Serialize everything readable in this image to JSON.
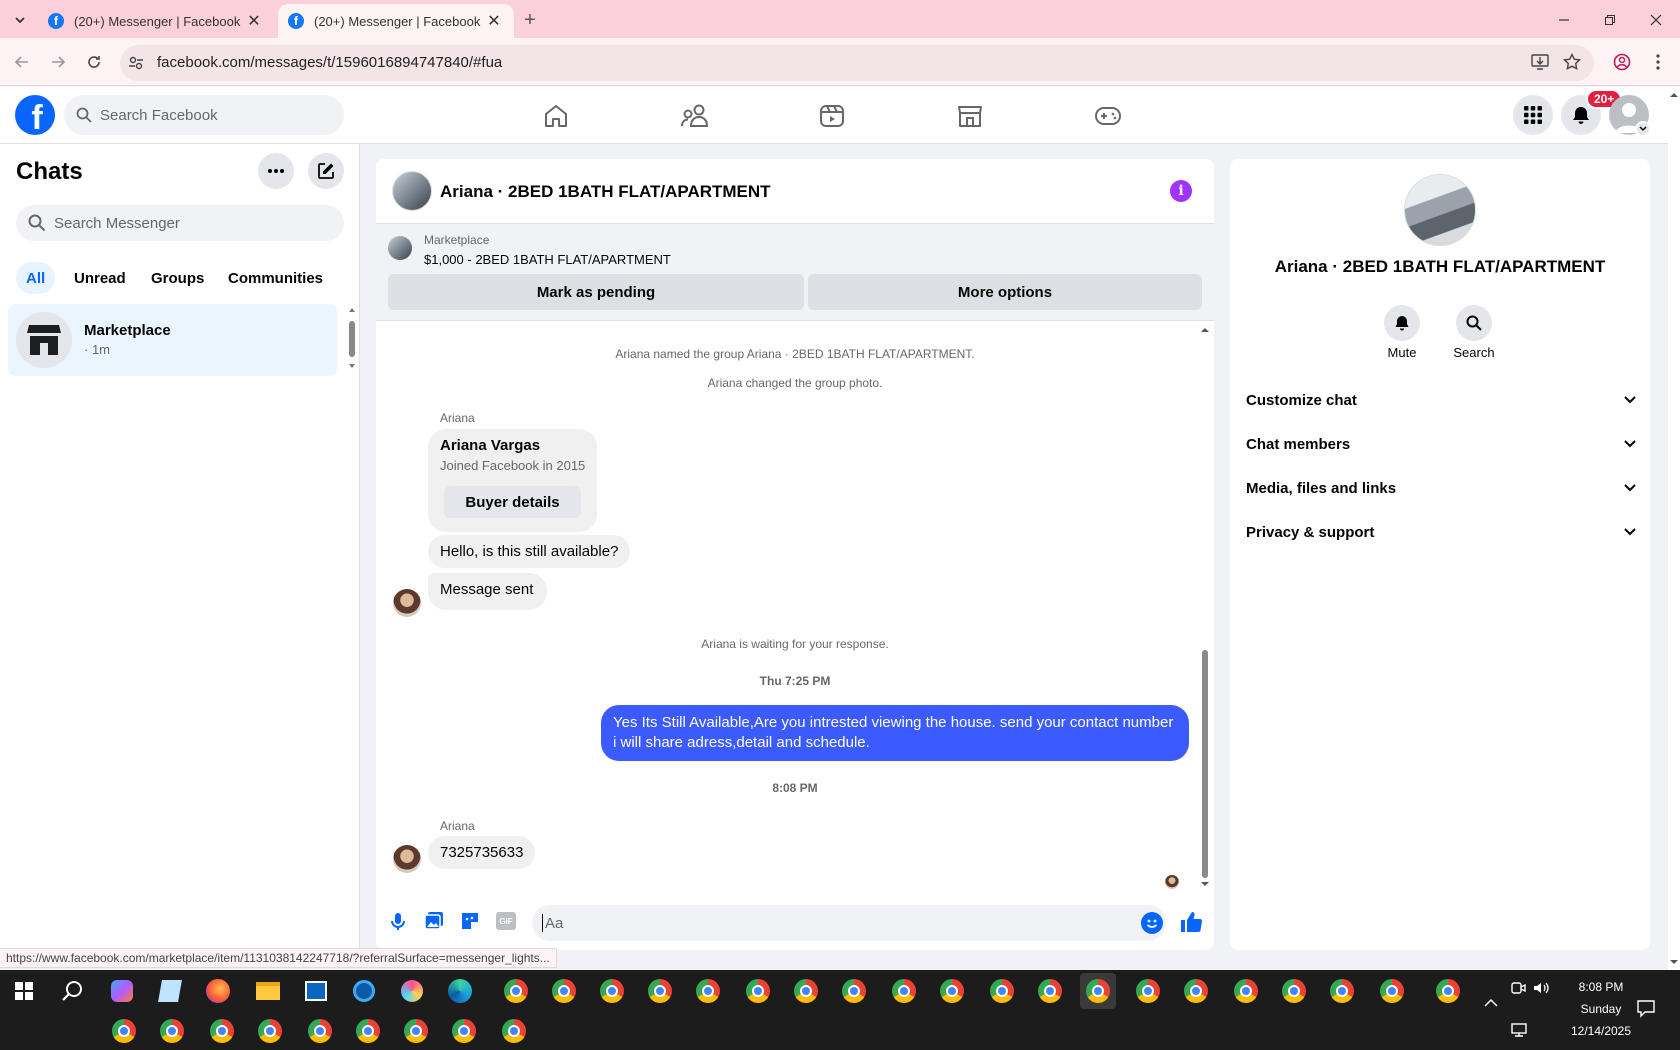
{
  "browser": {
    "tabs": [
      {
        "title": "(20+) Messenger | Facebook"
      },
      {
        "title": "(20+) Messenger | Facebook"
      }
    ],
    "url": "facebook.com/messages/t/1596016894747840/#fua",
    "status_url": "https://www.facebook.com/marketplace/item/1131038142247718/?referralSurface=messenger_lights..."
  },
  "fb": {
    "search_placeholder": "Search Facebook",
    "notification_badge": "20+"
  },
  "chats": {
    "title": "Chats",
    "search_placeholder": "Search Messenger",
    "filters": [
      "All",
      "Unread",
      "Groups",
      "Communities"
    ],
    "active_filter": "All",
    "items": [
      {
        "name": "Marketplace",
        "meta": "· 1m"
      }
    ]
  },
  "conversation": {
    "title": "Ariana · 2BED 1BATH FLAT/APARTMENT",
    "listing": {
      "label": "Marketplace",
      "price_title": "$1,000 - 2BED 1BATH FLAT/APARTMENT",
      "pending_button": "Mark as pending",
      "more_button": "More options"
    },
    "system_1": "Ariana named the group Ariana · 2BED 1BATH FLAT/APARTMENT.",
    "system_2": "Ariana changed the group photo.",
    "sender_1": "Ariana",
    "buyer_card": {
      "name": "Ariana Vargas",
      "joined": "Joined Facebook in 2015",
      "button": "Buyer details"
    },
    "msg_1": "Hello, is this still available?",
    "msg_2": "Message sent",
    "waiting": "Ariana is waiting for your response.",
    "time_1": "Thu 7:25 PM",
    "outgoing": "Yes Its Still Available,Are you intrested viewing the house. send your contact number i will share adress,detail and schedule.",
    "time_2": "8:08 PM",
    "sender_2": "Ariana",
    "msg_3": "7325735633",
    "composer_placeholder": "Aa"
  },
  "details": {
    "title": "Ariana · 2BED 1BATH FLAT/APARTMENT",
    "mute_label": "Mute",
    "search_label": "Search",
    "sections": [
      "Customize chat",
      "Chat members",
      "Media, files and links",
      "Privacy & support"
    ]
  },
  "taskbar": {
    "time": "8:08 PM",
    "day": "Sunday",
    "date": "12/14/2025"
  },
  "colors": {
    "accent": "#0866ff",
    "outgoing_bubble": "#3b5bfe",
    "tab_strip": "#fbd0da",
    "info_purple": "#a033ff"
  }
}
